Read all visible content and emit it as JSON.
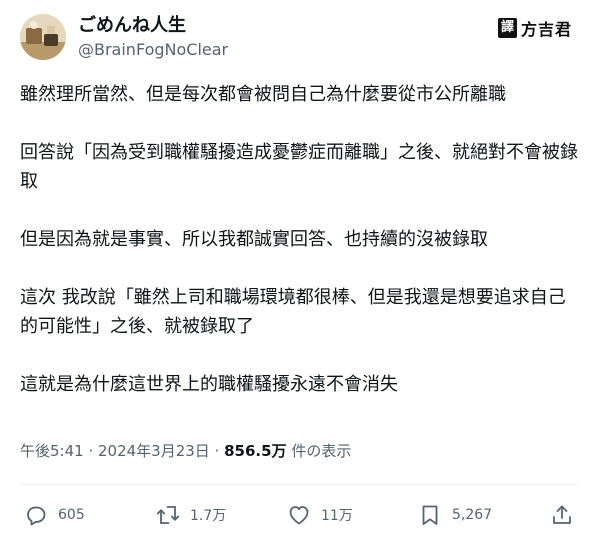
{
  "user": {
    "display_name": "ごめんね人生",
    "handle": "@BrainFogNoClear"
  },
  "watermark": {
    "badge": "譯",
    "text": "方吉君"
  },
  "tweet": {
    "paragraphs": [
      "雖然理所當然、但是每次都會被問自己為什麼要從市公所離職",
      "回答說「因為受到職權騷擾造成憂鬱症而離職」之後、就絕對不會被錄取",
      "但是因為就是事實、所以我都誠實回答、也持續的沒被錄取",
      "這次 我改說「雖然上司和職場環境都很棒、但是我還是想要追求自己的可能性」之後、就被錄取了",
      "這就是為什麼這世界上的職權騷擾永遠不會消失"
    ]
  },
  "meta": {
    "timestamp": "午後5:41 · 2024年3月23日 · ",
    "views": "856.5万",
    "views_suffix": " 件の表示"
  },
  "actions": {
    "replies": "605",
    "retweets": "1.7万",
    "likes": "11万",
    "bookmarks": "5,267"
  },
  "icons": {
    "reply": "reply-icon",
    "retweet": "retweet-icon",
    "like": "heart-icon",
    "bookmark": "bookmark-icon",
    "share": "share-icon"
  },
  "colors": {
    "text": "#0f1419",
    "secondary": "#536471",
    "divider": "#eff3f4"
  }
}
